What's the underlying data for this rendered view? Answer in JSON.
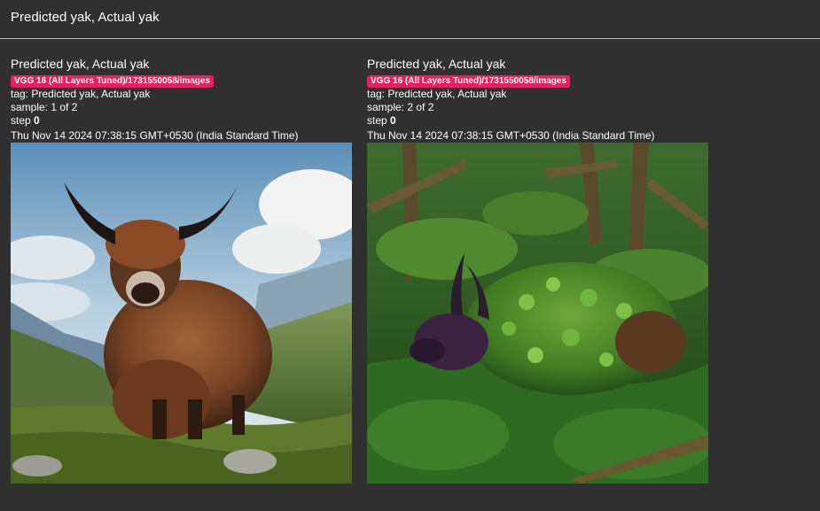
{
  "header": {
    "title": "Predicted yak, Actual yak"
  },
  "cards": [
    {
      "title": "Predicted yak, Actual yak",
      "run": "VGG 16 (All Layers Tuned)/1731550058/images",
      "tag_label": "tag:",
      "tag_value": "Predicted yak, Actual yak",
      "sample_label": "sample:",
      "sample_value": "1 of 2",
      "step_label": "step",
      "step_value": "0",
      "timestamp": "Thu Nov 14 2024 07:38:15 GMT+0530 (India Standard Time)"
    },
    {
      "title": "Predicted yak, Actual yak",
      "run": "VGG 16 (All Layers Tuned)/1731550058/images",
      "tag_label": "tag:",
      "tag_value": "Predicted yak, Actual yak",
      "sample_label": "sample:",
      "sample_value": "2 of 2",
      "step_label": "step",
      "step_value": "0",
      "timestamp": "Thu Nov 14 2024 07:38:15 GMT+0530 (India Standard Time)"
    }
  ],
  "colors": {
    "background": "#303030",
    "run_badge": "#e91e63"
  }
}
